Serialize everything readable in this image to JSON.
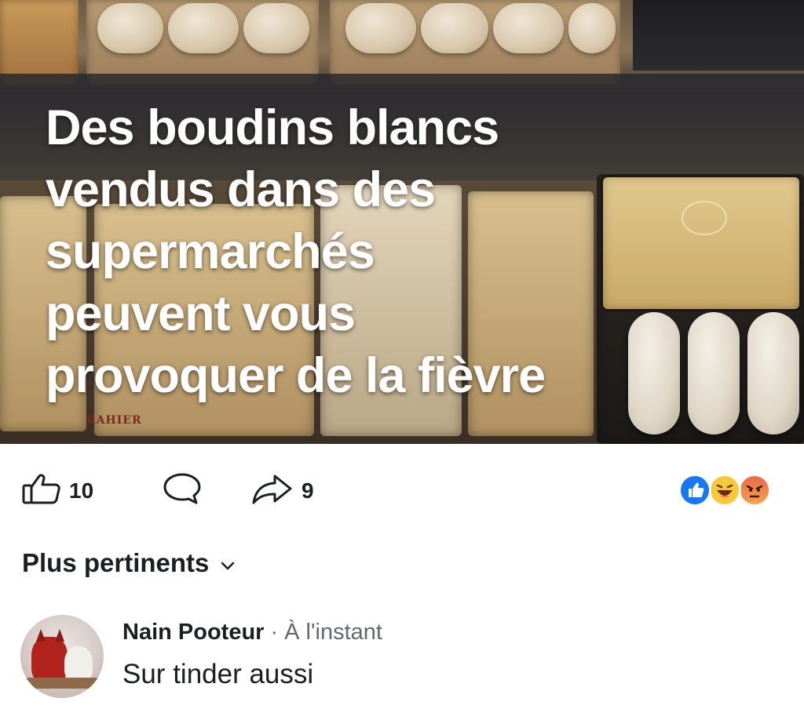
{
  "post": {
    "headline_lines": [
      "Des boudins blancs",
      "vendus dans des",
      "supermarchés",
      "peuvent vous",
      "provoquer de la fièvre"
    ],
    "pack_brand": "RAHIER"
  },
  "actions": {
    "like_icon": "thumbs-up-icon",
    "like_count": "10",
    "comment_icon": "comment-icon",
    "share_icon": "share-icon",
    "share_count": "9",
    "reactions": [
      "like",
      "haha",
      "angry"
    ],
    "colors": {
      "like": "#1877f2",
      "haha": "#f7c93a",
      "angry": "#e9694a"
    }
  },
  "comments": {
    "sort_label": "Plus pertinents",
    "sort_icon": "chevron-down-icon",
    "items": [
      {
        "author": "Nain Pooteur",
        "separator": "·",
        "time": "À l'instant",
        "text": "Sur tinder aussi"
      }
    ]
  }
}
